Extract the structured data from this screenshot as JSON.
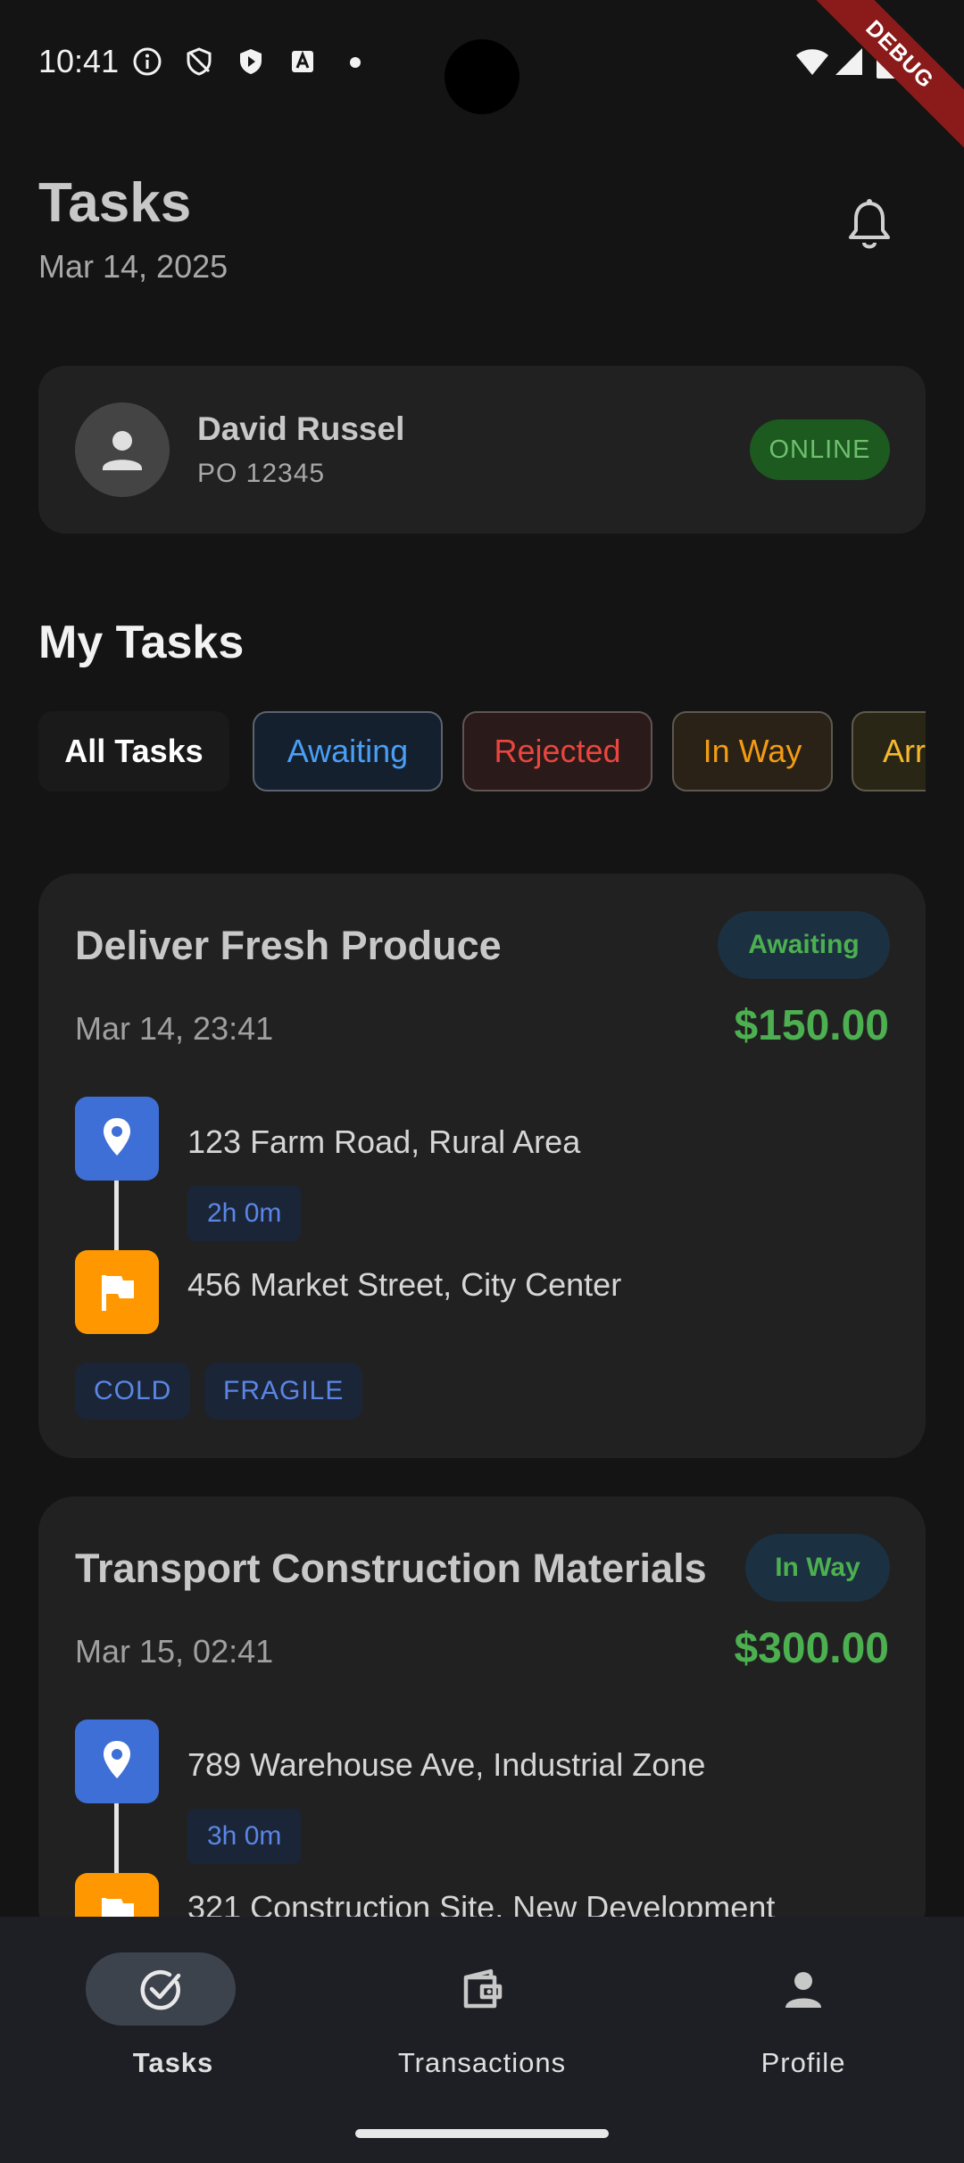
{
  "status_bar": {
    "time": "10:41",
    "debug_label": "DEBUG"
  },
  "header": {
    "title": "Tasks",
    "date": "Mar 14, 2025"
  },
  "profile": {
    "name": "David Russel",
    "po": "PO 12345",
    "status": "ONLINE"
  },
  "section_title": "My Tasks",
  "filters": [
    {
      "label": "All Tasks",
      "color": "#ffffff"
    },
    {
      "label": "Awaiting",
      "color": "#4a9ff5"
    },
    {
      "label": "Rejected",
      "color": "#e8463e"
    },
    {
      "label": "In Way",
      "color": "#f39c12"
    },
    {
      "label": "Arr",
      "color": "#f5b82e"
    }
  ],
  "tasks": [
    {
      "title": "Deliver Fresh Produce",
      "status": "Awaiting",
      "status_color": "#4caf50",
      "date": "Mar 14, 23:41",
      "price": "$150.00",
      "pickup": "123 Farm Road, Rural Area",
      "duration": "2h 0m",
      "dropoff": "456 Market Street, City Center",
      "tags": [
        "COLD",
        "FRAGILE"
      ]
    },
    {
      "title": "Transport Construction Materials",
      "status": "In Way",
      "status_color": "#4caf50",
      "date": "Mar 15, 02:41",
      "price": "$300.00",
      "pickup": "789 Warehouse Ave, Industrial Zone",
      "duration": "3h 0m",
      "dropoff": "321 Construction Site, New Development",
      "tags": []
    }
  ],
  "nav": [
    {
      "label": "Tasks",
      "icon": "check-circle-icon",
      "active": true
    },
    {
      "label": "Transactions",
      "icon": "wallet-icon",
      "active": false
    },
    {
      "label": "Profile",
      "icon": "person-icon",
      "active": false
    }
  ],
  "colors": {
    "background": "#141414",
    "card": "#212121",
    "price": "#4caf50",
    "pin": "#3e6fd6",
    "flag": "#ff9800"
  }
}
